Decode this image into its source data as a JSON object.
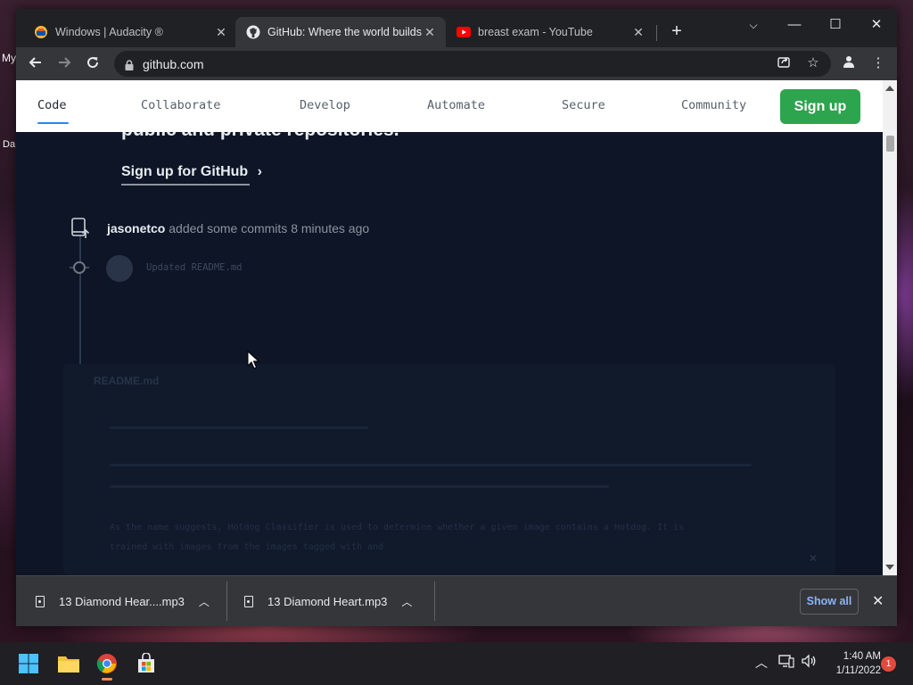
{
  "desktop": {
    "peek_labels": [
      "My",
      "Da"
    ]
  },
  "browser": {
    "tabs": [
      {
        "title": "Windows | Audacity ®",
        "favicon": "audacity-icon",
        "active": false
      },
      {
        "title": "GitHub: Where the world builds",
        "favicon": "github-icon",
        "active": true
      },
      {
        "title": "breast exam - YouTube",
        "favicon": "youtube-icon",
        "active": false
      }
    ],
    "address": "github.com",
    "window_controls": {
      "minimize": "—",
      "maximize": "☐",
      "close": "✕"
    }
  },
  "github": {
    "nav": {
      "items": [
        "Code",
        "Collaborate",
        "Develop",
        "Automate",
        "Secure",
        "Community"
      ],
      "active": "Code",
      "signup_label": "Sign up"
    },
    "hero_heading_clip": "public and private repositories.",
    "signup_link": "Sign up for GitHub",
    "commit_event": {
      "user": "jasonetco",
      "action": "added some commits 8 minutes ago"
    },
    "commit_message": "Updated README.md",
    "readme": {
      "filename": "README.md",
      "text_line1": "As the name suggests, Hotdog Classifier is used to determine whether a given image contains a Hotdog. It is",
      "text_line2": "trained with images from the              images tagged with                            and"
    }
  },
  "downloads": {
    "items": [
      {
        "name": "13 Diamond Hear....mp3"
      },
      {
        "name": "13 Diamond Heart.mp3"
      }
    ],
    "show_all": "Show all"
  },
  "taskbar": {
    "time": "1:40 AM",
    "date": "1/11/2022",
    "notification_count": "1"
  },
  "colors": {
    "github_green": "#2da44e",
    "page_bg": "#0d1526",
    "chrome_dark": "#202124",
    "chrome_toolbar": "#35363a",
    "link_blue": "#8ab4f8"
  }
}
